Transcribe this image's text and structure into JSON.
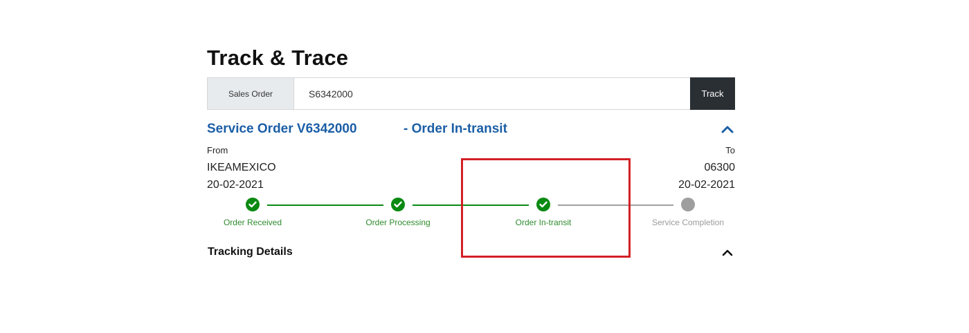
{
  "page": {
    "title": "Track & Trace"
  },
  "search": {
    "label": "Sales Order",
    "value": "S6342000",
    "button_label": "Track"
  },
  "order": {
    "title": "Service Order V6342000",
    "status": "- Order In-transit",
    "collapse_icon": "chevron-up-icon",
    "title_color": "#1b5ea6"
  },
  "shipment": {
    "from_label": "From",
    "from_value": "IKEAMEXICO",
    "from_date": "20-02-2021",
    "to_label": "To",
    "to_value": "06300",
    "to_date": "20-02-2021"
  },
  "progress": {
    "steps": [
      {
        "label": "Order Received",
        "status": "done"
      },
      {
        "label": "Order Processing",
        "status": "done"
      },
      {
        "label": "Order In-transit",
        "status": "done"
      },
      {
        "label": "Service Completion",
        "status": "pending"
      }
    ],
    "done_color": "#0a8a12",
    "pending_color": "#9e9e9e"
  },
  "tracking": {
    "title": "Tracking Details",
    "collapse_icon": "chevron-up-icon"
  },
  "annotation": {
    "highlight_color": "#d32027"
  }
}
